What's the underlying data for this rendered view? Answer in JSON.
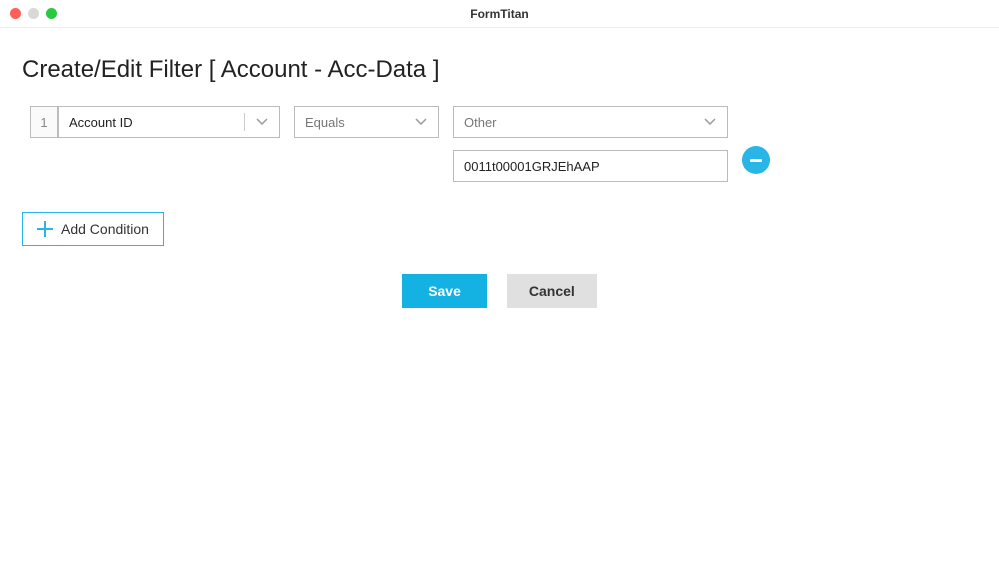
{
  "window": {
    "title": "FormTitan"
  },
  "page": {
    "heading": "Create/Edit Filter [ Account - Acc-Data ]"
  },
  "condition": {
    "index": "1",
    "field": "Account ID",
    "operator": "Equals",
    "value_type": "Other",
    "value": "0011t00001GRJEhAAP"
  },
  "buttons": {
    "add_condition": "Add Condition",
    "save": "Save",
    "cancel": "Cancel"
  }
}
